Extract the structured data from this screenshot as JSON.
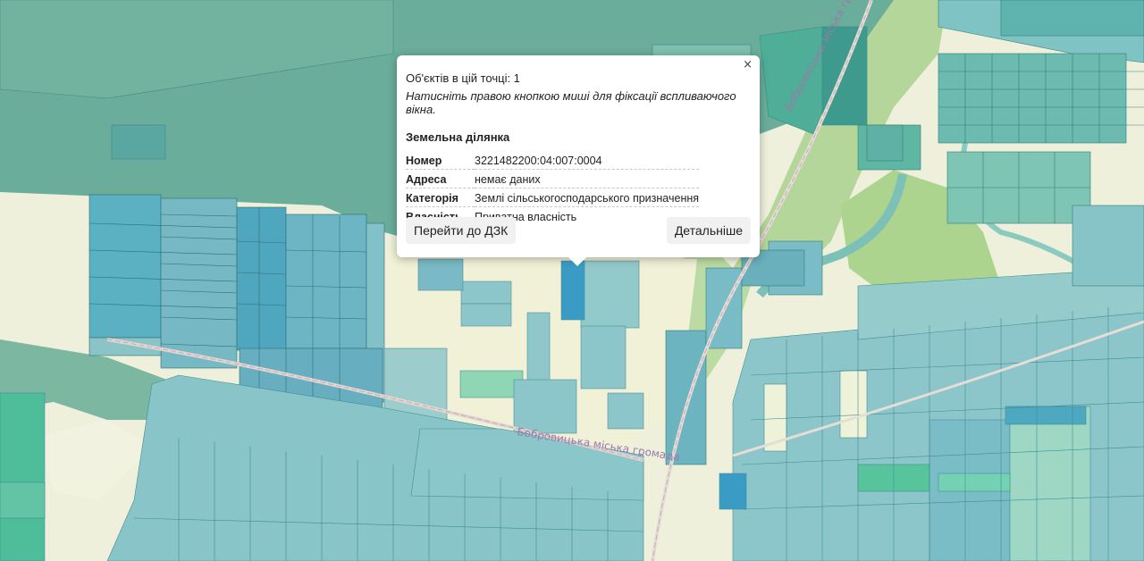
{
  "map": {
    "road_label_1": "Бобровицька міська громада",
    "road_label_2": "Бобровицька міська громада"
  },
  "popup": {
    "close_label": "×",
    "count_text": "Об'єктів в цій точці: 1",
    "hint_text": "Натисніть правою кнопкою миші для фіксації вспливаючого вікна.",
    "section_title": "Земельна ділянка",
    "rows": [
      {
        "label": "Номер",
        "value": "3221482200:04:007:0004"
      },
      {
        "label": "Адреса",
        "value": "немає даних"
      },
      {
        "label": "Категорія",
        "value": "Землі сільськогосподарського призначення"
      },
      {
        "label": "Власність",
        "value": "Приватна власність"
      }
    ],
    "dzk_button": "Перейти до ДЗК",
    "details_button": "Детальніше"
  },
  "colors": {
    "forest": "#6aad9b",
    "parcel": "#86c4c8",
    "parcel_dark": "#4ea8c0",
    "meadow": "#a9d18e",
    "farmland": "#f2f2dc",
    "selected_parcel": "#3a9cc4"
  }
}
